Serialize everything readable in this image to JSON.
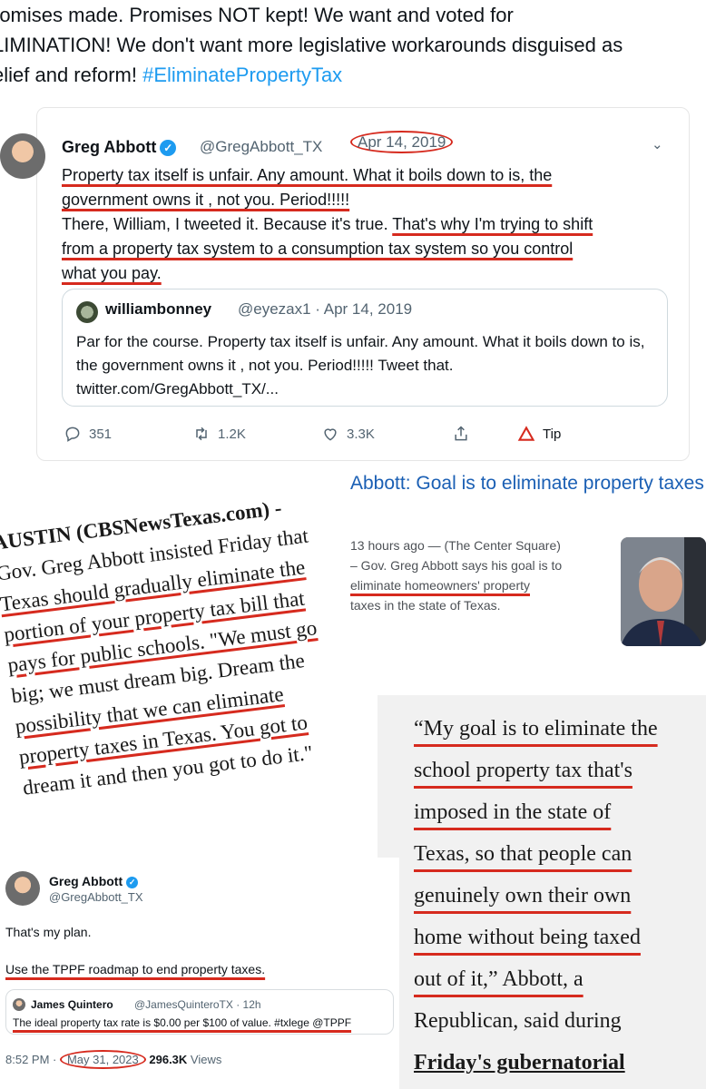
{
  "caption": {
    "line1": "romises made. Promises NOT kept! We want and voted for",
    "line2": "LIMINATION! We don't want more legislative workarounds disguised as",
    "line3_text": "elief and reform! ",
    "hashtag": "#EliminatePropertyTax"
  },
  "tweet1": {
    "name": "Greg Abbott",
    "verified_icon": "verified-badge-icon",
    "handle": "@GregAbbott_TX",
    "date": "Apr 14, 2019",
    "menu_icon": "chevron-down-icon",
    "line1": "Property tax itself is unfair. Any amount. What it boils down to is, the",
    "line2": "government owns it , not you. Period!!!!!",
    "line3a": "There, William, I tweeted it. Because it's true. ",
    "line3b": "That's why I'm trying to shift",
    "line4": "from a property tax system to a consumption tax system so you control",
    "line5": "what you pay.",
    "quote": {
      "name": "williambonney",
      "handle": "@eyezax1 · Apr 14, 2019",
      "text": "Par for the course.   Property tax itself is unfair. Any amount. What it boils down to is, the government owns it , not you. Period!!!!!   Tweet that. twitter.com/GregAbbott_TX/..."
    },
    "stats": {
      "replies": "351",
      "retweets": "1.2K",
      "likes": "3.3K",
      "tip": "Tip"
    }
  },
  "cbs": {
    "line1": "AUSTIN (CBSNewsTexas.com) -",
    "line2": "Gov. Greg Abbott insisted Friday that",
    "line3": "Texas should gradually eliminate the",
    "line4": "portion of your property tax bill that",
    "line5": "pays for public schools. \"We must go",
    "line6": "big; we must dream big. Dream the",
    "line7": "possibility that we can eliminate",
    "line8": "property taxes in Texas. You got to",
    "line9": "dream it and then you got to do it.\""
  },
  "news": {
    "title": "Abbott: Goal is to eliminate property taxes",
    "meta_line1": "13 hours ago — (The Center Square)",
    "meta_line2": "– Gov. Greg Abbott says his goal is to",
    "meta_line3": "eliminate homeowners' property",
    "meta_line4": "taxes in the state of Texas."
  },
  "quote4": {
    "l1": "“My goal is to eliminate the",
    "l2": "school property tax that's",
    "l3": "imposed in the state of",
    "l4": "Texas, so that people can",
    "l5": "genuinely own their own",
    "l6": "home without being taxed",
    "l7": "out of it,” Abbott, a",
    "l8": "Republican, said during",
    "l9": "Friday's gubernatorial"
  },
  "tweet3": {
    "name": "Greg Abbott",
    "handle": "@GregAbbott_TX",
    "line1": "That's my plan.",
    "line2": "Use the TPPF roadmap to end property taxes.",
    "quote_name": "James Quintero",
    "quote_handle": "@JamesQuinteroTX · 12h",
    "quote_text": "The ideal property tax rate is $0.00 per $100 of value. #txlege @TPPF",
    "time": "8:52 PM · ",
    "date": "May 31, 2023",
    "views": "296.3K",
    "views_label": " Views"
  },
  "colors": {
    "underline_red": "#d62a1e",
    "twitter_blue": "#1d9bf0",
    "link_blue": "#1a5fb4"
  }
}
